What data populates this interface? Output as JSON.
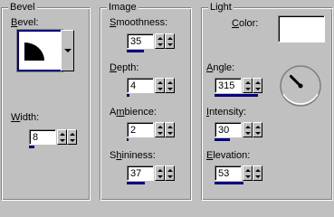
{
  "bevel": {
    "legend": "Bevel",
    "bevel_label_u": "B",
    "bevel_label_rest": "evel:",
    "width_label_u": "W",
    "width_label_rest": "idth:",
    "width_value": "8",
    "width_fraction": 0.1
  },
  "image": {
    "legend": "Image",
    "smoothness_label_u": "S",
    "smoothness_label_rest": "moothness:",
    "smoothness_value": "35",
    "smoothness_fraction": 0.35,
    "depth_label_u": "D",
    "depth_label_rest": "epth:",
    "depth_value": "4",
    "depth_fraction": 0.06,
    "ambience_label_pre": "A",
    "ambience_label_u": "m",
    "ambience_label_rest": "bience:",
    "ambience_value": "2",
    "ambience_fraction": 0.04,
    "shininess_label_pre": "S",
    "shininess_label_u": "h",
    "shininess_label_rest": "ininess:",
    "shininess_value": "37",
    "shininess_fraction": 0.37
  },
  "light": {
    "legend": "Light",
    "color_label_u": "C",
    "color_label_rest": "olor:",
    "color_value": "#ffffff",
    "angle_label_u": "A",
    "angle_label_rest": "ngle:",
    "angle_value": "315",
    "angle_fraction": 0.875,
    "intensity_label_u": "I",
    "intensity_label_rest": "ntensity:",
    "intensity_value": "30",
    "intensity_fraction": 0.3,
    "elevation_label_u": "E",
    "elevation_label_rest": "levation:",
    "elevation_value": "53",
    "elevation_fraction": 0.59
  },
  "colors": {
    "face": "#c0c0c0",
    "accent": "#000080"
  },
  "icons": {
    "bevel_preview": "quarter-round-bevel-icon",
    "dropdown": "chevron-down-icon",
    "angle_dial": "angle-dial-icon"
  }
}
